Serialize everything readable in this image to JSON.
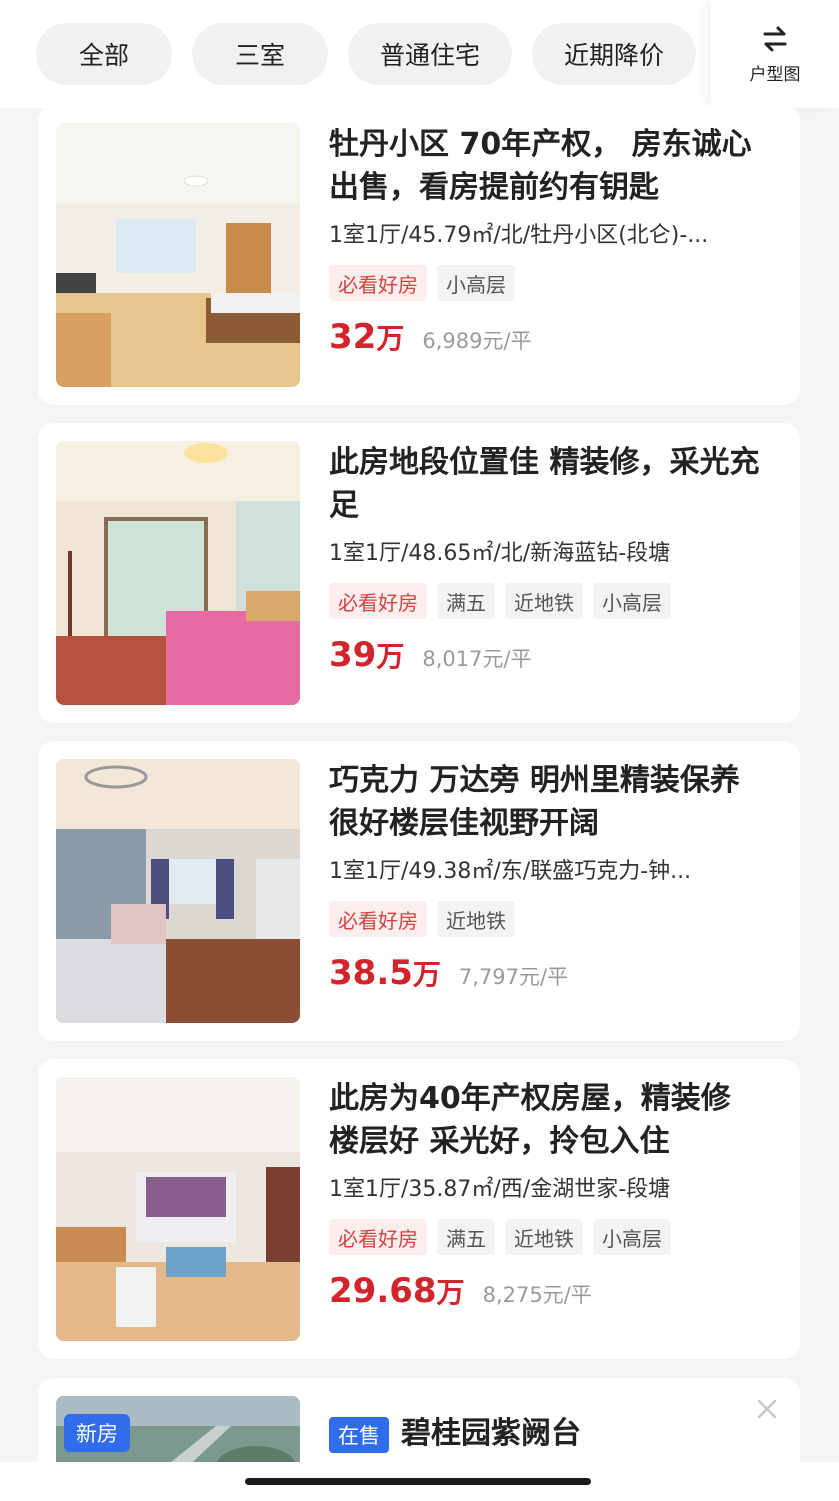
{
  "filters": {
    "chips": [
      "全部",
      "三室",
      "普通住宅",
      "近期降价"
    ],
    "layout_label": "户型图",
    "layout_icon": "swap-arrows-icon"
  },
  "listings": [
    {
      "title": "牡丹小区 70年产权， 房东诚心出售，看房提前约有钥匙",
      "meta": "1室1厅/45.79㎡/北/牡丹小区(北仑)-...",
      "tags": [
        "必看好房",
        "小高层"
      ],
      "price": "32",
      "price_unit": "万",
      "unit_price": "6,989元/平"
    },
    {
      "title": "此房地段位置佳 精装修，采光充足",
      "meta": "1室1厅/48.65㎡/北/新海蓝钻-段塘",
      "tags": [
        "必看好房",
        "满五",
        "近地铁",
        "小高层"
      ],
      "price": "39",
      "price_unit": "万",
      "unit_price": "8,017元/平"
    },
    {
      "title": "巧克力 万达旁 明州里精装保养很好楼层佳视野开阔",
      "meta": "1室1厅/49.38㎡/东/联盛巧克力-钟...",
      "tags": [
        "必看好房",
        "近地铁"
      ],
      "price": "38.5",
      "price_unit": "万",
      "unit_price": "7,797元/平"
    },
    {
      "title": "此房为40年产权房屋，精装修 楼层好 采光好，拎包入住",
      "meta": "1室1厅/35.87㎡/西/金湖世家-段塘",
      "tags": [
        "必看好房",
        "满五",
        "近地铁",
        "小高层"
      ],
      "price": "29.68",
      "price_unit": "万",
      "unit_price": "8,275元/平"
    }
  ],
  "promo": {
    "badge": "新房",
    "status": "在售",
    "name": "碧桂园紫阙台"
  },
  "colors": {
    "price_red": "#d1252b",
    "tag_hot_bg": "#fdeeee",
    "tag_hot_text": "#d64243",
    "accent_blue": "#2f6dea"
  }
}
